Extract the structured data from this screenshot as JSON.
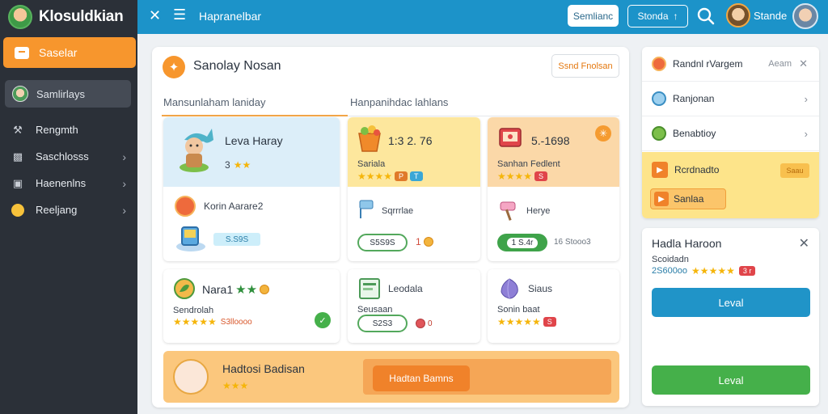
{
  "app": {
    "name": "Klosuldkian"
  },
  "sidebar": {
    "active": {
      "label": "Saselar"
    },
    "user": {
      "label": "Samlirlays"
    },
    "items": [
      {
        "label": "Rengmth",
        "icon": "wrench-icon",
        "chev": ""
      },
      {
        "label": "Saschlosss",
        "icon": "gamepad-icon",
        "chev": "›"
      },
      {
        "label": "Haenenlns",
        "icon": "folder-icon",
        "chev": "›"
      },
      {
        "label": "Reeljang",
        "icon": "smile-icon",
        "chev": "›"
      }
    ]
  },
  "topbar": {
    "close": "✕",
    "menu": "☰",
    "title": "Hapranelbar",
    "btn1": "Semlianc",
    "btn2": "Stonda",
    "btn2_suffix": "↑",
    "user": "Stande"
  },
  "main": {
    "title": "Sanolay Nosan",
    "icon": "✦",
    "action": "Ssnd Fnolsan",
    "tab1": "Mansunlaham laniday",
    "tab2": "Hanpanihdac lahlans",
    "cards": {
      "c1": {
        "title": "Leva Haray",
        "sub": "3",
        "row_title": "Korin Aarare2",
        "chip": "S.S9S"
      },
      "c2": {
        "title": "1:3 2. 76",
        "label": "Sariala",
        "item_title": "Sqrrrlae",
        "btn": "S5S9S",
        "num": "1"
      },
      "c3": {
        "title": "5.-1698",
        "label": "Sanhan Fedlent",
        "item_title": "Herye",
        "btn": "1 S.4r",
        "side": "16 Stooo3"
      },
      "c4": {
        "title": "Nara1",
        "label": "Sendrolah",
        "meta": "S3lloooo"
      },
      "c5": {
        "title": "Leodala",
        "label": "Seusaan",
        "btn": "S2S3",
        "num": "0"
      },
      "c6": {
        "title": "Siaus",
        "label": "Sonin baat"
      }
    },
    "banner": {
      "title": "Hadtosi Badisan",
      "button": "Hadtan Bamns"
    }
  },
  "right1": {
    "rows": [
      {
        "label": "Randnl rVargem",
        "end": "Aeam",
        "close": "✕"
      },
      {
        "label": "Ranjonan",
        "end": "›"
      },
      {
        "label": "Benabtioy",
        "end": "›"
      }
    ],
    "hl_row1": "Rcrdnadto",
    "hl_badge": "Saau",
    "hl_row2": "Sanlaa"
  },
  "right2": {
    "title": "Hadla Haroon",
    "sub": "Scoidadn",
    "meta": "2S600oo",
    "badge": "3 r",
    "btn_blue": "Leval",
    "btn_green": "Leval"
  },
  "colors": {
    "accent": "#f7962d",
    "topbar": "#1c93c9",
    "sidebar": "#2b3038",
    "green": "#45b04a"
  }
}
